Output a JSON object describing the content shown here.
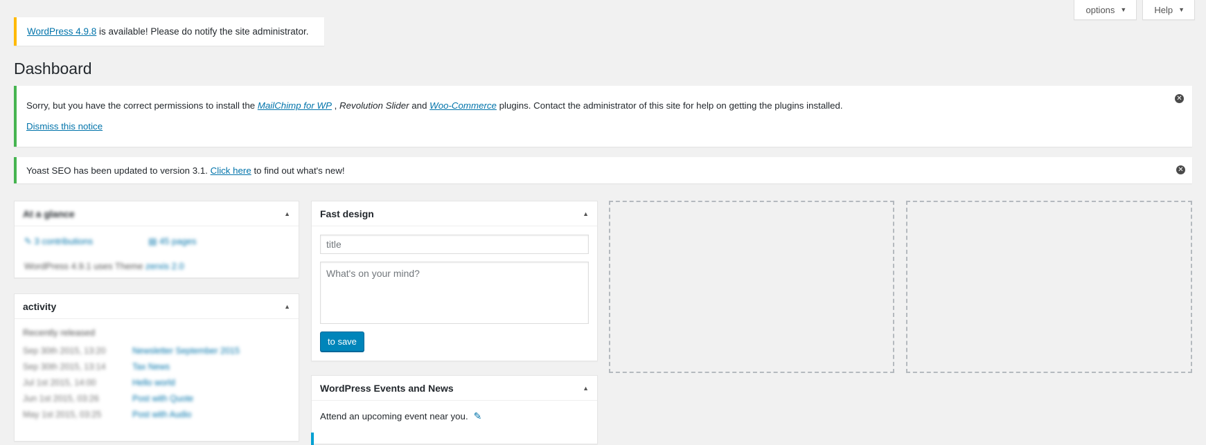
{
  "screen_options": {
    "options_label": "options",
    "help_label": "Help"
  },
  "update_nag": {
    "link_text": "WordPress 4.9.8",
    "rest_text": " is available! Please do notify the site administrator."
  },
  "page_title": "Dashboard",
  "plugin_notice": {
    "part1": "Sorry, but you have the correct permissions to install the ",
    "plugin1": "MailChimp for WP",
    "part2": " , ",
    "plugin2": "Revolution Slider",
    "part3": " and ",
    "plugin3": "Woo-Commerce",
    "part4": " plugins. Contact the administrator of this site for help on getting the plugins installed.",
    "dismiss_label": "Dismiss this notice",
    "close_icon": "close-icon"
  },
  "yoast_notice": {
    "part1": "Yoast SEO has been updated to version 3.1. ",
    "link_text": "Click here",
    "part2": " to find out what's new!"
  },
  "at_a_glance": {
    "title": "At a glance",
    "contributions": "3 contributions",
    "pages": "45 pages",
    "version_line": "WordPress 4.9.1 uses Theme",
    "theme_link": "zerxis 2.0"
  },
  "activity": {
    "title": "activity",
    "heading": "Recently released",
    "rows": [
      {
        "date": "Sep 30th 2015, 13:20",
        "title": "Newsletter September 2015"
      },
      {
        "date": "Sep 30th 2015, 13:14",
        "title": "Tax News"
      },
      {
        "date": "Jul 1st 2015, 14:00",
        "title": "Hello world"
      },
      {
        "date": "Jun 1st 2015, 03:26",
        "title": "Post with Quote"
      },
      {
        "date": "May 1st 2015, 03:25",
        "title": "Post with Audio"
      }
    ]
  },
  "quick_draft": {
    "title": "Fast design",
    "title_placeholder": "title",
    "content_placeholder": "What's on your mind?",
    "save_label": "to save"
  },
  "events": {
    "title": "WordPress Events and News",
    "attend_text": "Attend an upcoming event near you."
  },
  "colors": {
    "accent": "#0073aa",
    "button": "#0085ba",
    "notice_success": "#46b450",
    "notice_warning": "#ffb900"
  }
}
